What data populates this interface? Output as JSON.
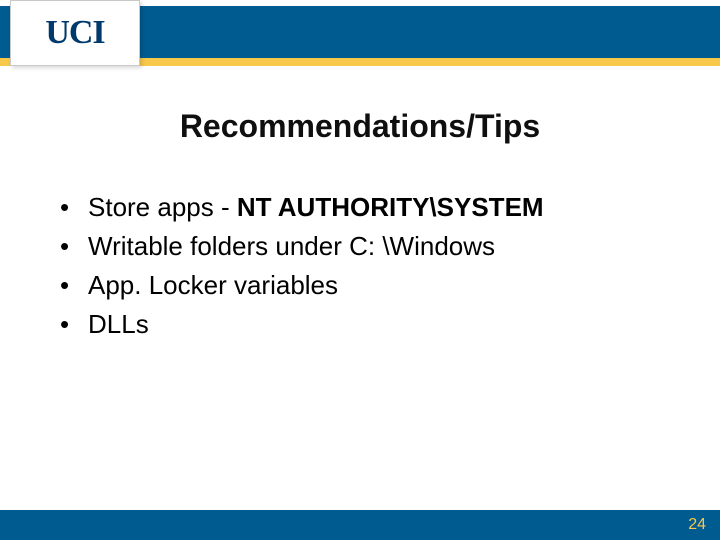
{
  "logo": {
    "text": "UCI"
  },
  "title": "Recommendations/Tips",
  "bullets": [
    {
      "prefix": "Store apps - ",
      "bold": "NT AUTHORITY\\SYSTEM"
    },
    {
      "text": "Writable folders under C: \\Windows"
    },
    {
      "text": "App. Locker variables"
    },
    {
      "text": "DLLs"
    }
  ],
  "page_number": "24"
}
